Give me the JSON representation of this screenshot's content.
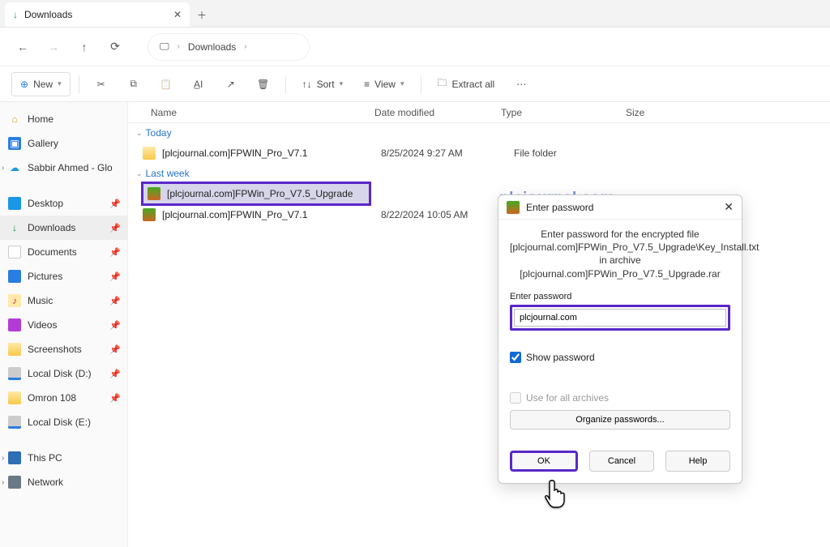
{
  "tab": {
    "title": "Downloads"
  },
  "breadcrumb": {
    "location": "Downloads"
  },
  "toolbar": {
    "new": "New",
    "sort": "Sort",
    "view": "View",
    "extract": "Extract all"
  },
  "sidebar": {
    "home": "Home",
    "gallery": "Gallery",
    "onedrive": "Sabbir Ahmed - Glo",
    "desktop": "Desktop",
    "downloads": "Downloads",
    "documents": "Documents",
    "pictures": "Pictures",
    "music": "Music",
    "videos": "Videos",
    "screenshots": "Screenshots",
    "disk_d": "Local Disk (D:)",
    "omron": "Omron 108",
    "disk_e": "Local Disk (E:)",
    "thispc": "This PC",
    "network": "Network"
  },
  "columns": {
    "name": "Name",
    "date": "Date modified",
    "type": "Type",
    "size": "Size"
  },
  "groups": {
    "today": "Today",
    "lastweek": "Last week"
  },
  "files": {
    "today_folder": {
      "name": "[plcjournal.com]FPWIN_Pro_V7.1",
      "date": "8/25/2024 9:27 AM",
      "type": "File folder"
    },
    "sel": {
      "name": "[plcjournal.com]FPWin_Pro_V7.5_Upgrade"
    },
    "rar2": {
      "name": "[plcjournal.com]FPWIN_Pro_V7.1",
      "date": "8/22/2024 10:05 AM"
    }
  },
  "watermark": "plcjournal.com",
  "dialog": {
    "title": "Enter password",
    "info_line1": "Enter password for the encrypted file",
    "info_line2": "[plcjournal.com]FPWin_Pro_V7.5_Upgrade\\Key_Install.txt",
    "info_line3": "in archive [plcjournal.com]FPWin_Pro_V7.5_Upgrade.rar",
    "label": "Enter password",
    "value": "plcjournal.com",
    "show_pw": "Show password",
    "use_all": "Use for all archives",
    "organize": "Organize passwords...",
    "ok": "OK",
    "cancel": "Cancel",
    "help": "Help"
  }
}
